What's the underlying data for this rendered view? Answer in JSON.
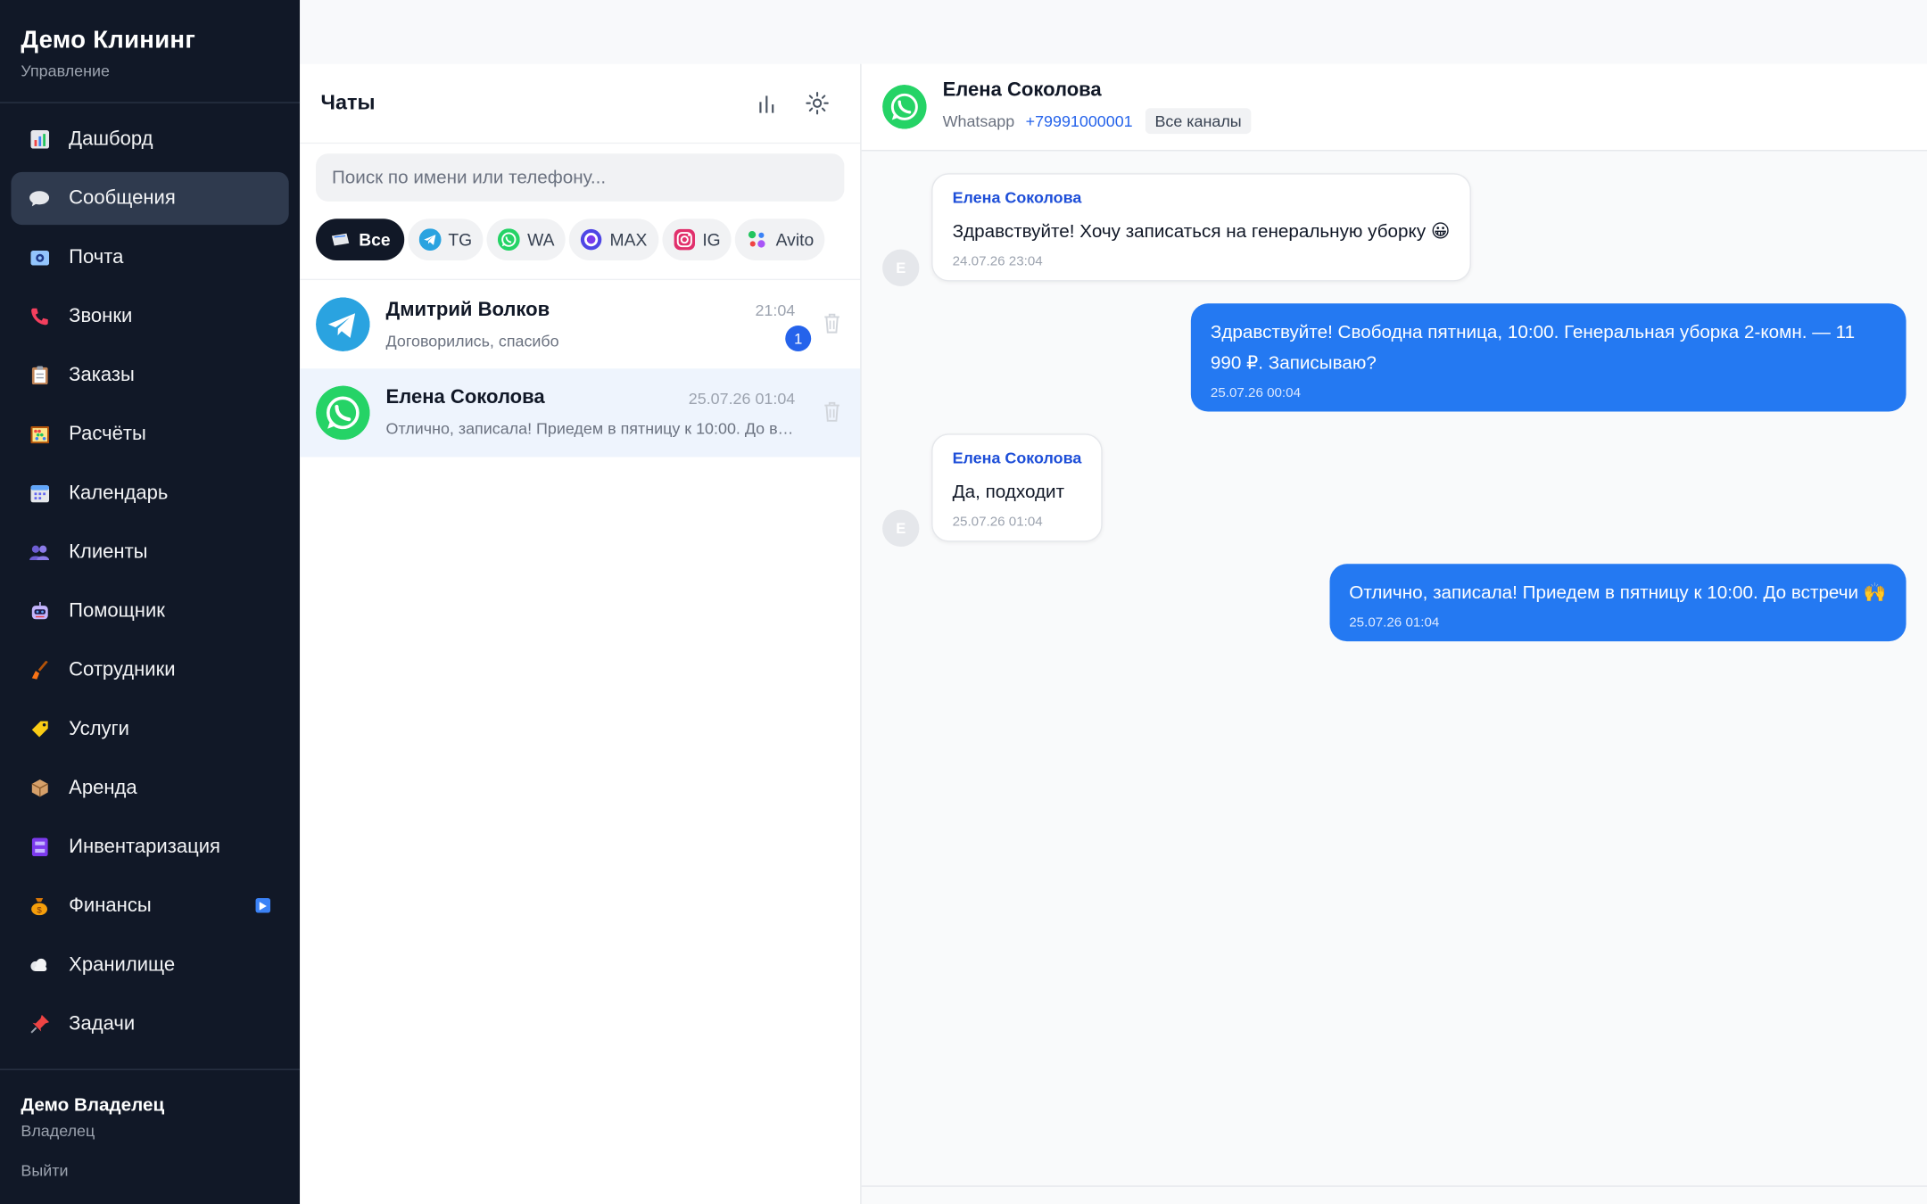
{
  "brand": {
    "title": "Демо Клининг",
    "subtitle": "Управление"
  },
  "nav": [
    {
      "label": "Дашборд",
      "icon": "chart-icon"
    },
    {
      "label": "Сообщения",
      "icon": "speech-bubble-icon",
      "active": true
    },
    {
      "label": "Почта",
      "icon": "mail-icon"
    },
    {
      "label": "Звонки",
      "icon": "phone-icon"
    },
    {
      "label": "Заказы",
      "icon": "clipboard-icon"
    },
    {
      "label": "Расчёты",
      "icon": "abacus-icon"
    },
    {
      "label": "Календарь",
      "icon": "calendar-icon"
    },
    {
      "label": "Клиенты",
      "icon": "people-icon"
    },
    {
      "label": "Помощник",
      "icon": "robot-icon"
    },
    {
      "label": "Сотрудники",
      "icon": "broom-icon"
    },
    {
      "label": "Услуги",
      "icon": "tag-icon"
    },
    {
      "label": "Аренда",
      "icon": "package-icon"
    },
    {
      "label": "Инвентаризация",
      "icon": "inventory-icon"
    },
    {
      "label": "Финансы",
      "icon": "money-bag-icon",
      "badge": "play-icon"
    },
    {
      "label": "Хранилище",
      "icon": "cloud-icon"
    },
    {
      "label": "Задачи",
      "icon": "pin-icon"
    }
  ],
  "user": {
    "name": "Демо Владелец",
    "role": "Владелец",
    "logout": "Выйти"
  },
  "chatlist": {
    "title": "Чаты",
    "search_placeholder": "Поиск по имени или телефону...",
    "filters": [
      {
        "label": "Все",
        "icon": "all-icon",
        "active": true
      },
      {
        "label": "TG",
        "icon": "telegram-icon"
      },
      {
        "label": "WA",
        "icon": "whatsapp-icon"
      },
      {
        "label": "MAX",
        "icon": "max-icon"
      },
      {
        "label": "IG",
        "icon": "instagram-icon"
      },
      {
        "label": "Avito",
        "icon": "avito-icon"
      }
    ],
    "conversations": [
      {
        "name": "Дмитрий Волков",
        "time": "21:04",
        "preview": "Договорились, спасибо",
        "unread": "1",
        "channel": "telegram"
      },
      {
        "name": "Елена Соколова",
        "time": "25.07.26 01:04",
        "preview": "Отлично, записала! Приедем в пятницу к 10:00. До встречи 🙌",
        "channel": "whatsapp",
        "selected": true
      }
    ]
  },
  "chat": {
    "name": "Елена Соколова",
    "channel": "Whatsapp",
    "phone": "+79991000001",
    "tag": "Все каналы",
    "messages": [
      {
        "dir": "in",
        "sender": "Елена Соколова",
        "text": "Здравствуйте! Хочу записаться на генеральную уборку 😀",
        "time": "24.07.26 23:04",
        "avatar": "Е"
      },
      {
        "dir": "out",
        "text": "Здравствуйте! Свободна пятница, 10:00. Генеральная уборка 2-комн. — 11 990 ₽. Записываю?",
        "time": "25.07.26 00:04"
      },
      {
        "dir": "in",
        "sender": "Елена Соколова",
        "text": "Да, подходит",
        "time": "25.07.26 01:04",
        "avatar": "Е"
      },
      {
        "dir": "out",
        "text": "Отлично, записала! Приедем в пятницу к 10:00. До встречи 🙌",
        "time": "25.07.26 01:04"
      }
    ]
  },
  "colors": {
    "sidebar": "#111827",
    "accent": "#2479f2",
    "whatsapp": "#25d366",
    "telegram": "#2aa3e0"
  }
}
